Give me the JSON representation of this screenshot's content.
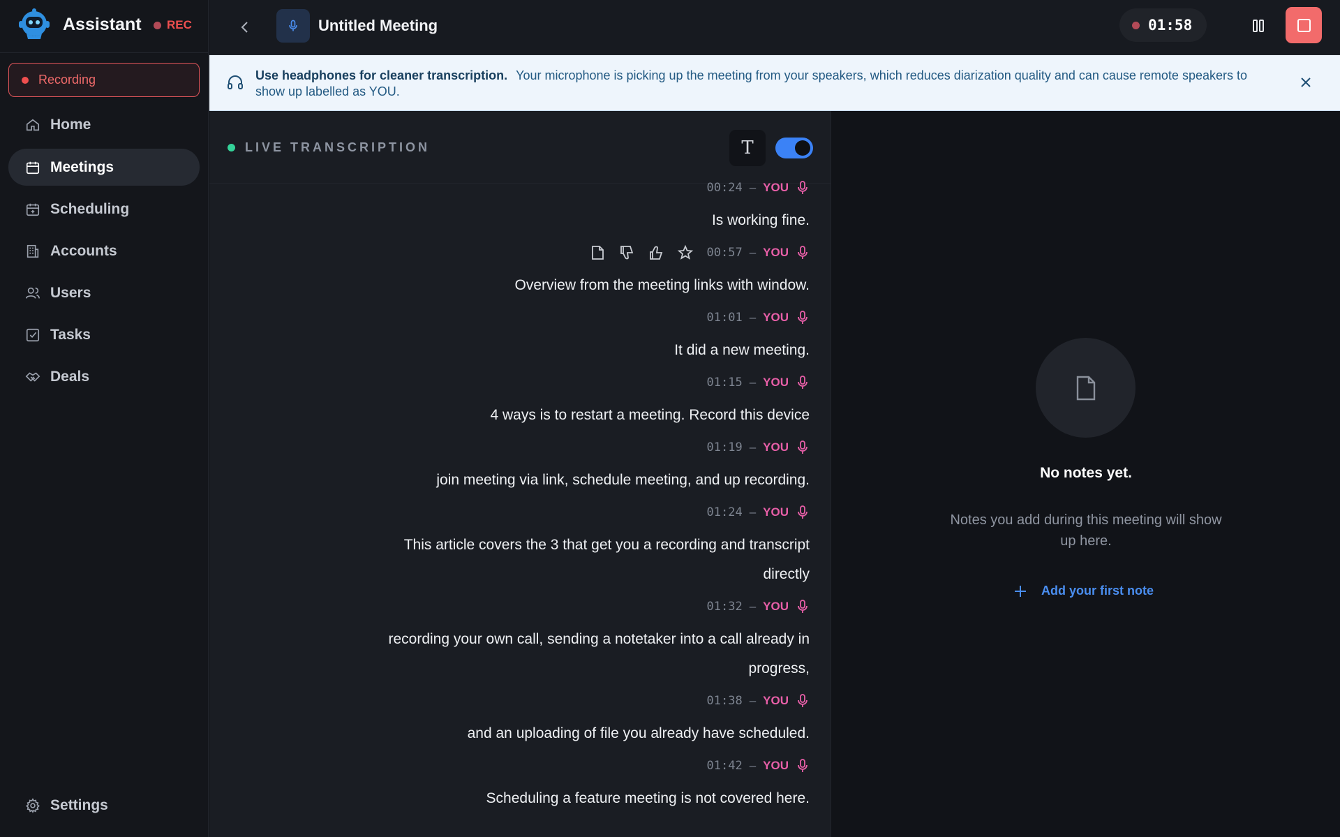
{
  "app": {
    "name": "Assistant",
    "rec_badge": "REC"
  },
  "sidebar": {
    "recording_label": "Recording",
    "items": [
      {
        "label": "Home",
        "icon": "home-icon",
        "active": false
      },
      {
        "label": "Meetings",
        "icon": "calendar-icon",
        "active": true
      },
      {
        "label": "Scheduling",
        "icon": "calendar-plus-icon",
        "active": false
      },
      {
        "label": "Accounts",
        "icon": "building-icon",
        "active": false
      },
      {
        "label": "Users",
        "icon": "users-icon",
        "active": false
      },
      {
        "label": "Tasks",
        "icon": "checkbox-icon",
        "active": false
      },
      {
        "label": "Deals",
        "icon": "handshake-icon",
        "active": false
      }
    ],
    "settings_label": "Settings"
  },
  "header": {
    "meeting_title": "Untitled Meeting",
    "timer": "01:58"
  },
  "banner": {
    "title": "Use headphones for cleaner transcription.",
    "message": "Your microphone is picking up the meeting from your speakers, which reduces diarization quality and can cause remote speakers to show up labelled as YOU."
  },
  "transcript": {
    "label": "LIVE TRANSCRIPTION",
    "font_button": "T",
    "toggle_on": true,
    "separator": "–",
    "segments": [
      {
        "time": "00:24",
        "speaker": "YOU",
        "text": "Is working fine."
      },
      {
        "time": "00:57",
        "speaker": "YOU",
        "text": "Overview from the meeting links with window."
      },
      {
        "time": "01:01",
        "speaker": "YOU",
        "text": "It did a new meeting."
      },
      {
        "time": "01:15",
        "speaker": "YOU",
        "text": "4 ways is to restart a meeting. Record this device"
      },
      {
        "time": "01:19",
        "speaker": "YOU",
        "text": "join meeting via link, schedule meeting, and up recording."
      },
      {
        "time": "01:24",
        "speaker": "YOU",
        "text": "This article covers the 3 that get you a recording and transcript directly"
      },
      {
        "time": "01:32",
        "speaker": "YOU",
        "text": "recording your own call, sending a notetaker into a call already in progress,"
      },
      {
        "time": "01:38",
        "speaker": "YOU",
        "text": "and an uploading of file you already have scheduled."
      },
      {
        "time": "01:42",
        "speaker": "YOU",
        "text": "Scheduling a feature meeting is not covered here."
      }
    ]
  },
  "notes": {
    "empty_title": "No notes yet.",
    "empty_subtitle": "Notes you add during this meeting will show up here.",
    "add_label": "Add your first note"
  },
  "colors": {
    "accent": "#3b82f6",
    "recording": "#ef4f4f",
    "speaker": "#e85fa8",
    "live": "#34d399",
    "banner_bg": "#eef5fc"
  }
}
